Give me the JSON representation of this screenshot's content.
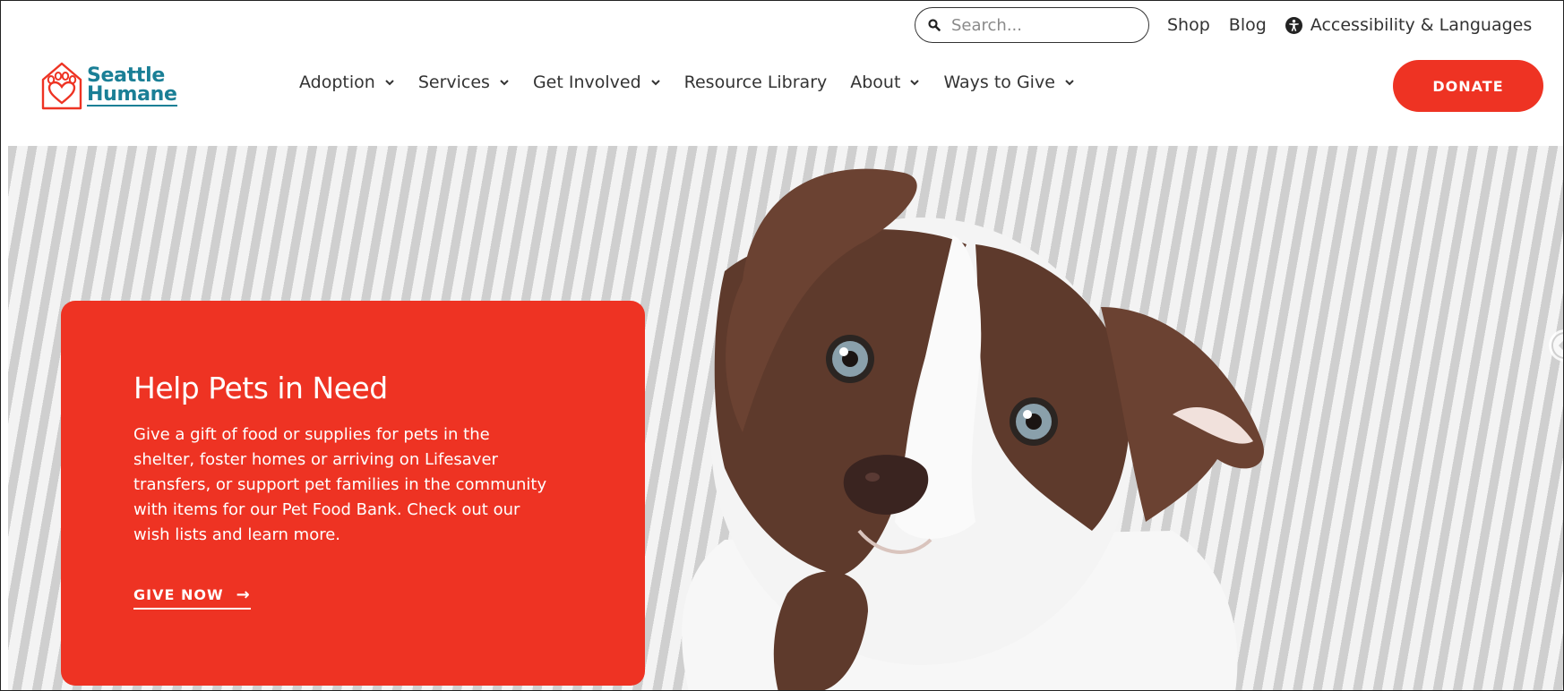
{
  "utility": {
    "search_placeholder": "Search...",
    "shop": "Shop",
    "blog": "Blog",
    "accessibility": "Accessibility & Languages"
  },
  "logo": {
    "line1": "Seattle",
    "line2": "Humane"
  },
  "nav": {
    "items": [
      {
        "label": "Adoption",
        "dropdown": true
      },
      {
        "label": "Services",
        "dropdown": true
      },
      {
        "label": "Get Involved",
        "dropdown": true
      },
      {
        "label": "Resource Library",
        "dropdown": false
      },
      {
        "label": "About",
        "dropdown": true
      },
      {
        "label": "Ways to Give",
        "dropdown": true
      }
    ],
    "donate": "DONATE"
  },
  "hero": {
    "title": "Help Pets in Need",
    "body": "Give a gift of food or supplies for pets in the shelter, foster homes or arriving on Lifesaver transfers, or support pet families in the community with items for our Pet Food Bank. Check out our wish lists and learn more.",
    "cta": "GIVE NOW",
    "cta_arrow": "→"
  },
  "colors": {
    "brand_red": "#ee3323",
    "brand_teal": "#1a7f96",
    "text_dark": "#333333"
  },
  "icons": {
    "search": "search-icon",
    "accessibility": "accessibility-icon",
    "chevron": "chevron-down-icon",
    "carousel": "arrow-left-icon"
  }
}
